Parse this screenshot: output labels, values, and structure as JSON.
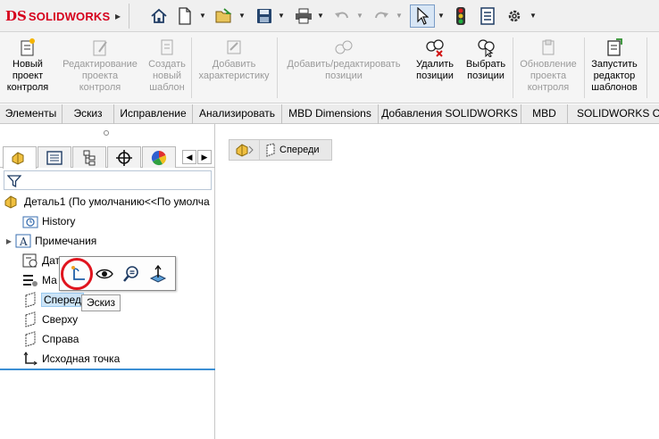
{
  "app": {
    "brand": "SOLIDWORKS",
    "logo_mark": "DS"
  },
  "quick_access": {
    "items": [
      {
        "icon": "home-icon"
      },
      {
        "icon": "new-document-icon"
      },
      {
        "icon": "open-folder-icon"
      },
      {
        "icon": "save-icon"
      },
      {
        "icon": "print-icon"
      },
      {
        "icon": "undo-icon"
      },
      {
        "icon": "redo-icon"
      },
      {
        "icon": "select-arrow-icon"
      },
      {
        "icon": "traffic-light-icon"
      },
      {
        "icon": "file-properties-icon"
      },
      {
        "icon": "gear-icon"
      }
    ]
  },
  "ribbon": {
    "buttons": [
      {
        "label": "Новый\nпроект\nконтроля",
        "enabled": true,
        "icon": "new-inspection-project-icon"
      },
      {
        "label": "Редактирование\nпроекта\nконтроля",
        "enabled": false,
        "icon": "edit-inspection-project-icon"
      },
      {
        "label": "Создать\nновый\nшаблон",
        "enabled": false,
        "icon": "new-template-icon"
      },
      {
        "label": "Добавить\nхарактеристику",
        "enabled": false,
        "icon": "add-characteristic-icon"
      },
      {
        "label": "Добавить/редактировать\nпозиции",
        "enabled": false,
        "icon": "add-edit-balloons-icon"
      },
      {
        "label": "Удалить\nпозиции",
        "enabled": true,
        "icon": "delete-balloons-icon"
      },
      {
        "label": "Выбрать\nпозиции",
        "enabled": true,
        "icon": "select-balloons-icon"
      },
      {
        "label": "Обновление\nпроекта\nконтроля",
        "enabled": false,
        "icon": "update-project-icon"
      },
      {
        "label": "Запустить\nредактор\nшаблонов",
        "enabled": true,
        "icon": "template-editor-icon"
      }
    ]
  },
  "tabs": [
    {
      "label": "Элементы"
    },
    {
      "label": "Эскиз"
    },
    {
      "label": "Исправление"
    },
    {
      "label": "Анализировать"
    },
    {
      "label": "MBD Dimensions"
    },
    {
      "label": "Добавления SOLIDWORKS"
    },
    {
      "label": "MBD"
    },
    {
      "label": "SOLIDWORKS CA"
    }
  ],
  "feature_tree": {
    "root": "Деталь1  (По умолчанию<<По умолча",
    "items": [
      {
        "label": "History",
        "icon": "history-folder-icon"
      },
      {
        "label": "Примечания",
        "icon": "annotations-icon"
      },
      {
        "label": "Дат",
        "icon": "sensors-icon"
      },
      {
        "label": "Ма",
        "icon": "material-icon"
      },
      {
        "label": "Сперед",
        "icon": "plane-icon"
      },
      {
        "label": "Сверху",
        "icon": "plane-icon"
      },
      {
        "label": "Справа",
        "icon": "plane-icon"
      },
      {
        "label": "Исходная точка",
        "icon": "origin-icon"
      }
    ]
  },
  "context_toolbar": {
    "tooltip": "Эскиз"
  },
  "breadcrumb": {
    "plane": "Спереди"
  },
  "colors": {
    "brand_red": "#d6001c",
    "highlight_circle": "#e0141e",
    "selection": "#cce4f7",
    "accent_blue": "#3c8fd4"
  }
}
